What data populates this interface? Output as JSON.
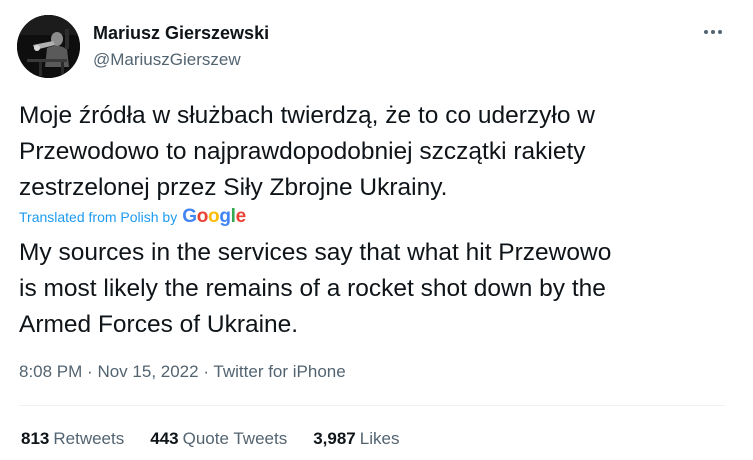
{
  "author": {
    "name": "Mariusz Gierszewski",
    "handle": "@MariuszGierszew"
  },
  "tweet": {
    "original_text": "Moje źródła w służbach twierdzą, że to co uderzyło w\nPrzewodowo to najprawdopodobniej szczątki rakiety\nzestrzelonej przez Siły Zbrojne Ukrainy.",
    "translated_from": "Translated from Polish by",
    "translator_logo": "Google",
    "translation": "My sources in the services say that what hit Przewowo\nis most likely the remains of a rocket shot down by the\nArmed Forces of Ukraine.",
    "time": "8:08 PM",
    "date": "Nov 15, 2022",
    "source": "Twitter for iPhone",
    "separator": "·"
  },
  "stats": {
    "retweets_count": "813",
    "retweets_label": "Retweets",
    "quote_tweets_count": "443",
    "quote_tweets_label": "Quote Tweets",
    "likes_count": "3,987",
    "likes_label": "Likes"
  },
  "icons": {
    "more": "more-horizontal-icon",
    "google": "google-logo"
  },
  "colors": {
    "text_primary": "#0f1419",
    "text_secondary": "#536471",
    "link_blue": "#1d9bf0",
    "divider": "#eff3f4"
  }
}
